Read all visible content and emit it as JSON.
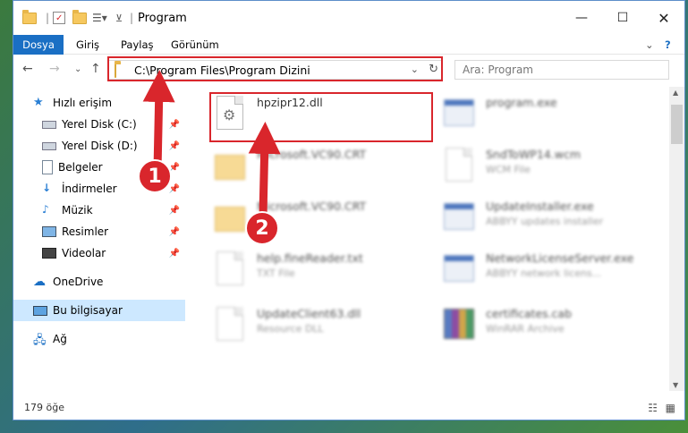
{
  "window": {
    "title": "Program"
  },
  "ribbon": {
    "tabs": [
      "Dosya",
      "Giriş",
      "Paylaş",
      "Görünüm"
    ]
  },
  "address": {
    "path": "C:\\Program Files\\Program Dizini"
  },
  "search": {
    "placeholder": "Ara: Program"
  },
  "sidebar": {
    "items": [
      {
        "label": "Hızlı erişim"
      },
      {
        "label": "Yerel Disk (C:)"
      },
      {
        "label": "Yerel Disk (D:)"
      },
      {
        "label": "Belgeler"
      },
      {
        "label": "İndirmeler"
      },
      {
        "label": "Müzik"
      },
      {
        "label": "Resimler"
      },
      {
        "label": "Videolar"
      },
      {
        "label": "OneDrive"
      },
      {
        "label": "Bu bilgisayar"
      },
      {
        "label": "Ağ"
      }
    ]
  },
  "files": [
    {
      "name": "hpzipr12.dll",
      "sub": ""
    },
    {
      "name": "program.exe",
      "sub": ""
    },
    {
      "name": "Microsoft.VC90.CRT",
      "sub": ""
    },
    {
      "name": "SndToWP14.wcm",
      "sub": "WCM File"
    },
    {
      "name": "Microsoft.VC90.CRT",
      "sub": ""
    },
    {
      "name": "UpdateInstaller.exe",
      "sub": "ABBYY updates installer"
    },
    {
      "name": "help.fineReader.txt",
      "sub": "TXT File"
    },
    {
      "name": "NetworkLicenseServer.exe",
      "sub": "ABBYY network licens..."
    },
    {
      "name": "UpdateClient63.dll",
      "sub": "Resource DLL"
    },
    {
      "name": "certificates.cab",
      "sub": "WinRAR Archive"
    }
  ],
  "status": {
    "count": "179 öğe"
  },
  "annotations": {
    "badge1": "1",
    "badge2": "2"
  }
}
